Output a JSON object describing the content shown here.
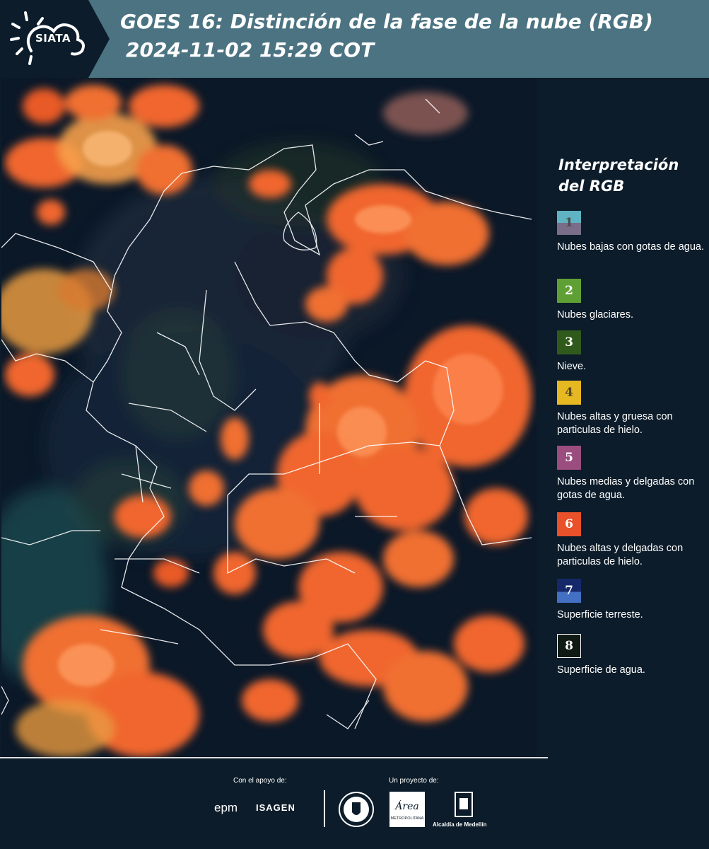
{
  "header": {
    "logo_text": "SIATA",
    "title_line1": "GOES 16: Distinción de la fase de la nube (RGB)",
    "title_line2": "2024-11-02 15:29 COT"
  },
  "legend": {
    "title": "Interpretación del RGB",
    "items": [
      {
        "number": "1",
        "label": "Nubes bajas con gotas de agua.",
        "color_top": "#5fb3c2",
        "color_bottom": "#7a6d8a",
        "text_color": "#4a4a4a"
      },
      {
        "number": "2",
        "label": "Nubes glaciares.",
        "color_top": "#5fa034",
        "color_bottom": "#5fa034",
        "text_color": "#ffffff"
      },
      {
        "number": "3",
        "label": "Nieve.",
        "color_top": "#2f5a1c",
        "color_bottom": "#2f5a1c",
        "text_color": "#ffffff"
      },
      {
        "number": "4",
        "label": "Nubes altas y gruesa con particulas de hielo.",
        "color_top": "#e6b822",
        "color_bottom": "#e6b822",
        "text_color": "#5a4a20"
      },
      {
        "number": "5",
        "label": "Nubes medias y delgadas con gotas de agua.",
        "color_top": "#9a4d7e",
        "color_bottom": "#9a4d7e",
        "text_color": "#ffffff"
      },
      {
        "number": "6",
        "label": "Nubes altas y delgadas con particulas de hielo.",
        "color_top": "#e8512a",
        "color_bottom": "#e8512a",
        "text_color": "#ffffff"
      },
      {
        "number": "7",
        "label": "Superficie terreste.",
        "color_top": "#16286a",
        "color_bottom": "#4470c4",
        "text_color": "#ffffff"
      },
      {
        "number": "8",
        "label": "Superficie de agua.",
        "color_top": "#101a14",
        "color_bottom": "#101a14",
        "text_color": "#ffffff"
      }
    ]
  },
  "footer": {
    "support_label": "Con el apoyo de:",
    "project_label": "Un proyecto de:",
    "sponsor_1": "epm",
    "sponsor_2": "ISAGEN",
    "area_logo_text": "Área",
    "area_logo_sub": "METROPOLITANA",
    "alcaldia": "Alcaldía de Medellín"
  },
  "colors": {
    "header_bg": "#4b7382",
    "panel_bg": "#0c1c2a",
    "cloud_orange": "#f0662f",
    "cloud_yellow": "#f5a04a",
    "border_white": "#ffffff"
  }
}
